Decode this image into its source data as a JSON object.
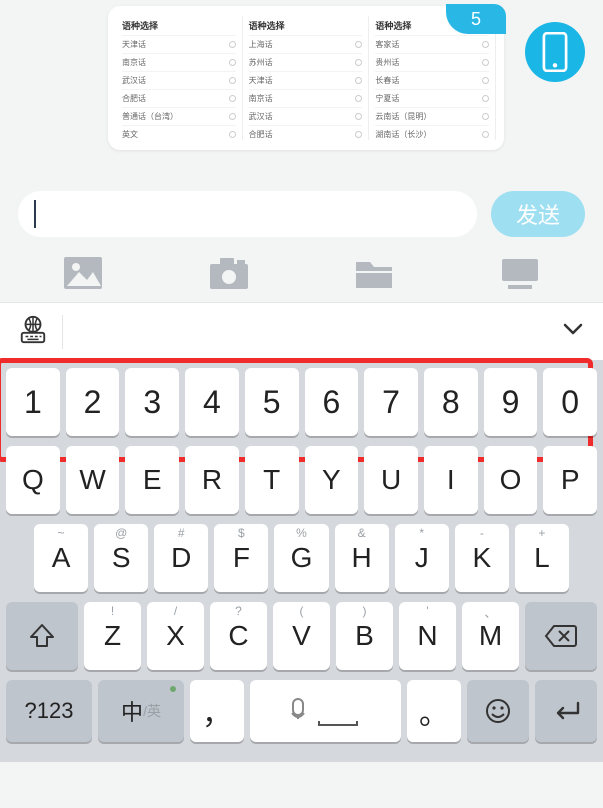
{
  "bubble": {
    "badge": "5",
    "col_title": "语种选择",
    "cols": [
      [
        "天津话",
        "南京话",
        "武汉话",
        "合肥话",
        "普通话（台湾）",
        "英文"
      ],
      [
        "上海话",
        "苏州话",
        "天津话",
        "南京话",
        "武汉话",
        "合肥话"
      ],
      [
        "客家话",
        "贵州话",
        "长春话",
        "宁夏话",
        "云南话（昆明）",
        "湖南话（长沙）"
      ]
    ]
  },
  "input": {
    "value": "",
    "send_label": "发送"
  },
  "keyboard": {
    "row_num": [
      "1",
      "2",
      "3",
      "4",
      "5",
      "6",
      "7",
      "8",
      "9",
      "0"
    ],
    "row_qwe": [
      "Q",
      "W",
      "E",
      "R",
      "T",
      "Y",
      "U",
      "I",
      "O",
      "P"
    ],
    "row_asd": [
      "A",
      "S",
      "D",
      "F",
      "G",
      "H",
      "J",
      "K",
      "L"
    ],
    "row_asd_sup": [
      "~",
      "@",
      "#",
      "$",
      "%",
      "&",
      "*",
      "-",
      "+"
    ],
    "row_zxc": [
      "Z",
      "X",
      "C",
      "V",
      "B",
      "N",
      "M"
    ],
    "row_zxc_sup": [
      "!",
      "/",
      "?",
      "(",
      ")",
      "'",
      "、"
    ],
    "modekey": "?123",
    "lang_cn": "中",
    "lang_en": "/英",
    "comma": "，",
    "period": "。"
  }
}
